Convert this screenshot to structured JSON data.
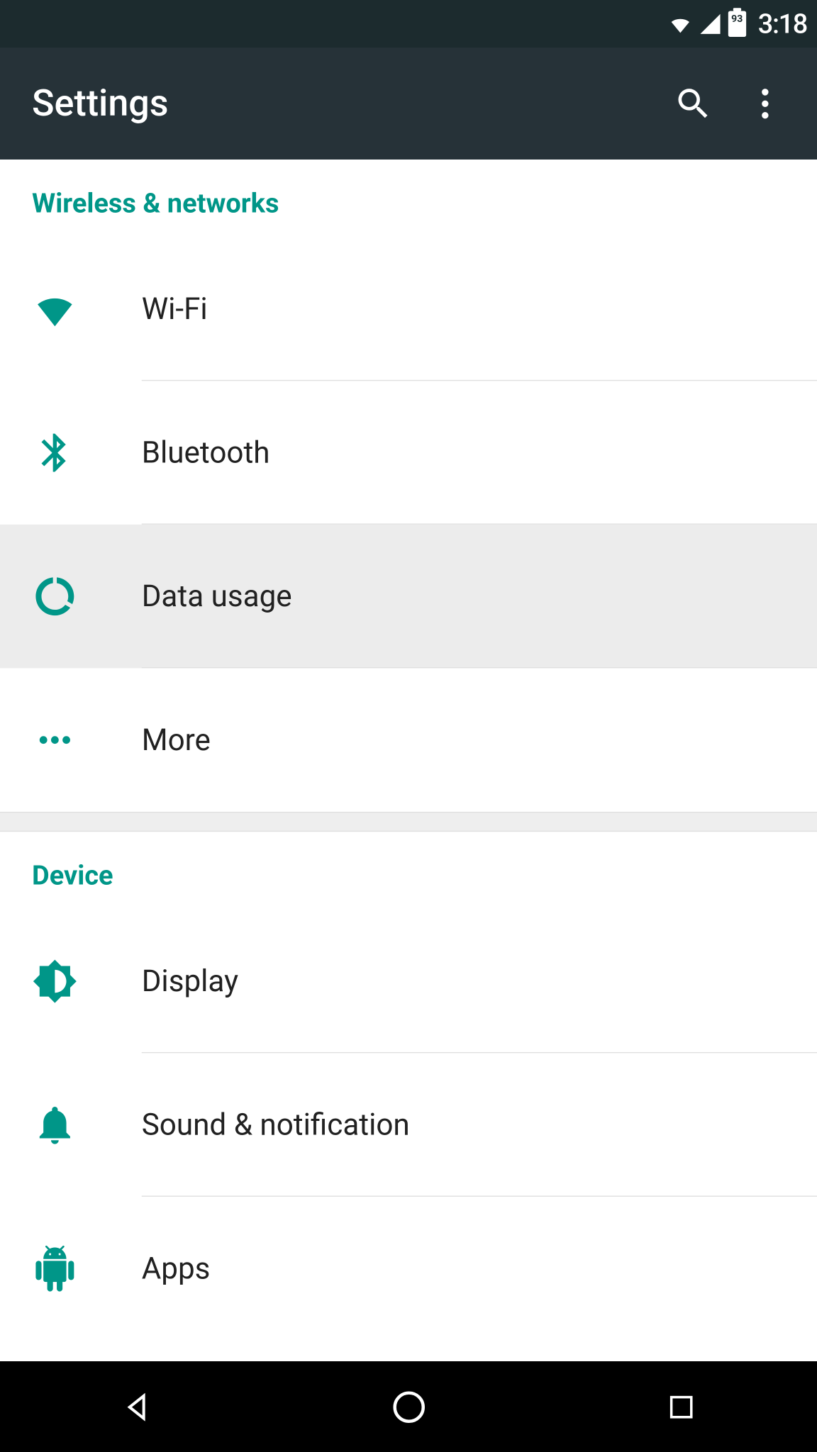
{
  "status": {
    "time": "3:18",
    "battery_pct": "93"
  },
  "appbar": {
    "title": "Settings"
  },
  "sections": [
    {
      "header": "Wireless & networks",
      "items": [
        "Wi-Fi",
        "Bluetooth",
        "Data usage",
        "More"
      ]
    },
    {
      "header": "Device",
      "items": [
        "Display",
        "Sound & notification",
        "Apps"
      ]
    }
  ],
  "colors": {
    "accent": "#009688",
    "appbar": "#263238",
    "statusbar": "#1c2b2e"
  }
}
